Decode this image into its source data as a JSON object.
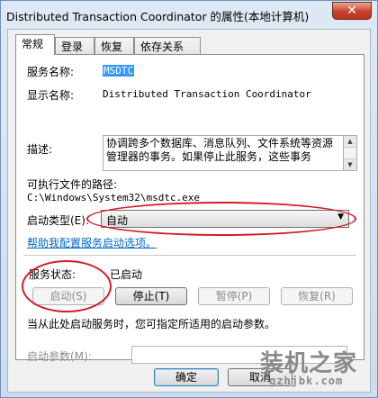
{
  "window": {
    "title": "Distributed Transaction Coordinator 的属性(本地计算机)",
    "close_label": "✕"
  },
  "tabs": [
    {
      "label": "常规"
    },
    {
      "label": "登录"
    },
    {
      "label": "恢复"
    },
    {
      "label": "依存关系"
    }
  ],
  "general": {
    "service_name_label": "服务名称:",
    "service_name": "MSDTC",
    "display_name_label": "显示名称:",
    "display_name": "Distributed Transaction Coordinator",
    "description_label": "描述:",
    "description": "协调跨多个数据库、消息队列、文件系统等资源管理器的事务。如果停止此服务，这些事务",
    "exec_path_label": "可执行文件的路径:",
    "exec_path": "C:\\Windows\\System32\\msdtc.exe",
    "startup_type_label": "启动类型(E):",
    "startup_type": "自动",
    "help_link": "帮助我配置服务启动选项。",
    "status_label": "服务状态:",
    "status": "已启动",
    "buttons": {
      "start": "启动(S)",
      "stop": "停止(T)",
      "pause": "暂停(P)",
      "resume": "恢复(R)"
    },
    "hint": "当从此处启动服务时，您可指定所适用的启动参数。",
    "params_label": "启动参数(M):",
    "params_value": ""
  },
  "footer": {
    "ok": "确定",
    "cancel": "取消"
  },
  "watermark": {
    "text": "装机之家",
    "url": "gzhjbk.com"
  },
  "colors": {
    "annotation": "#d8182a",
    "link": "#0066cc",
    "selection": "#3399ff"
  }
}
